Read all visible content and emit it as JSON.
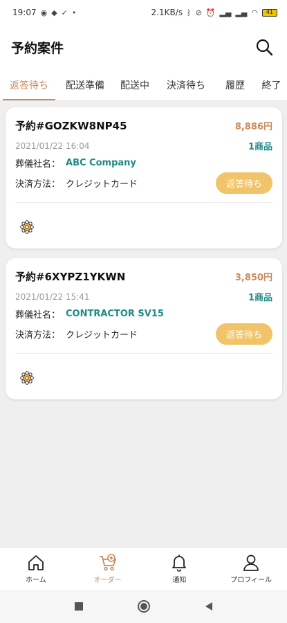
{
  "status_bar": {
    "time": "19:07",
    "net_speed": "2.1KB/s",
    "battery": "41"
  },
  "appbar": {
    "title": "予約案件",
    "search_icon": "search-icon"
  },
  "tabs": [
    {
      "label": "返答待ち",
      "active": true
    },
    {
      "label": "配送準備",
      "active": false
    },
    {
      "label": "配送中",
      "active": false
    },
    {
      "label": "決済待ち",
      "active": false
    },
    {
      "label": "履歴",
      "active": false
    },
    {
      "label": "終了",
      "active": false
    }
  ],
  "orders": [
    {
      "id": "予約#GOZKW8NP45",
      "price": "8,886円",
      "datetime": "2021/01/22 16:04",
      "item_count": "1商品",
      "company_label": "葬儀社名：",
      "company": "ABC Company",
      "payment_label": "決済方法：",
      "payment": "クレジットカード",
      "status": "返答待ち"
    },
    {
      "id": "予約#6XYPZ1YKWN",
      "price": "3,850円",
      "datetime": "2021/01/22 15:41",
      "item_count": "1商品",
      "company_label": "葬儀社名：",
      "company": "CONTRACTOR SV15",
      "payment_label": "決済方法：",
      "payment": "クレジットカード",
      "status": "返答待ち"
    }
  ],
  "bottom_nav": [
    {
      "label": "ホーム",
      "icon": "home-icon",
      "active": false
    },
    {
      "label": "オーダー",
      "icon": "order-icon",
      "active": true
    },
    {
      "label": "通知",
      "icon": "bell-icon",
      "active": false
    },
    {
      "label": "プロフィール",
      "icon": "user-icon",
      "active": false
    }
  ],
  "colors": {
    "accent": "#c98a5a",
    "teal": "#1f8a87",
    "status_button": "#f1c46a"
  }
}
